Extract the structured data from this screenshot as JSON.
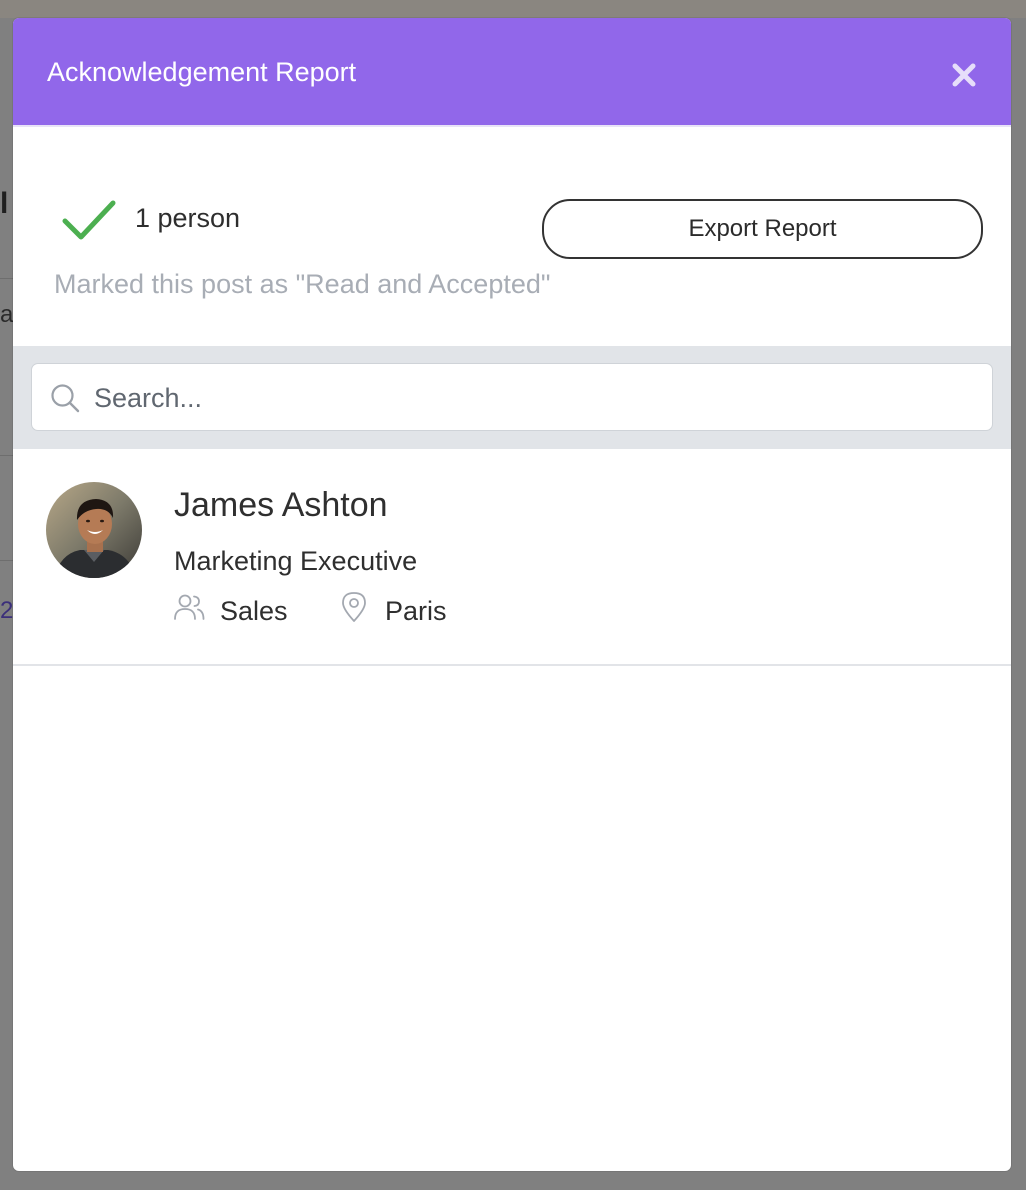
{
  "modal": {
    "title": "Acknowledgement Report",
    "close_icon": "close-icon"
  },
  "summary": {
    "check_icon": "checkmark-icon",
    "count_text": "1 person",
    "export_label": "Export Report",
    "status_text": "Marked this post as \"Read and Accepted\""
  },
  "search": {
    "icon": "search-icon",
    "placeholder": "Search...",
    "value": ""
  },
  "people": [
    {
      "name": "James Ashton",
      "role": "Marketing Executive",
      "team": "Sales",
      "team_icon": "users-icon",
      "location": "Paris",
      "location_icon": "map-pin-icon"
    }
  ],
  "colors": {
    "header": "#9167ea",
    "check": "#4caf50",
    "muted_text": "#a8adb5",
    "search_band": "#e1e4e8"
  }
}
